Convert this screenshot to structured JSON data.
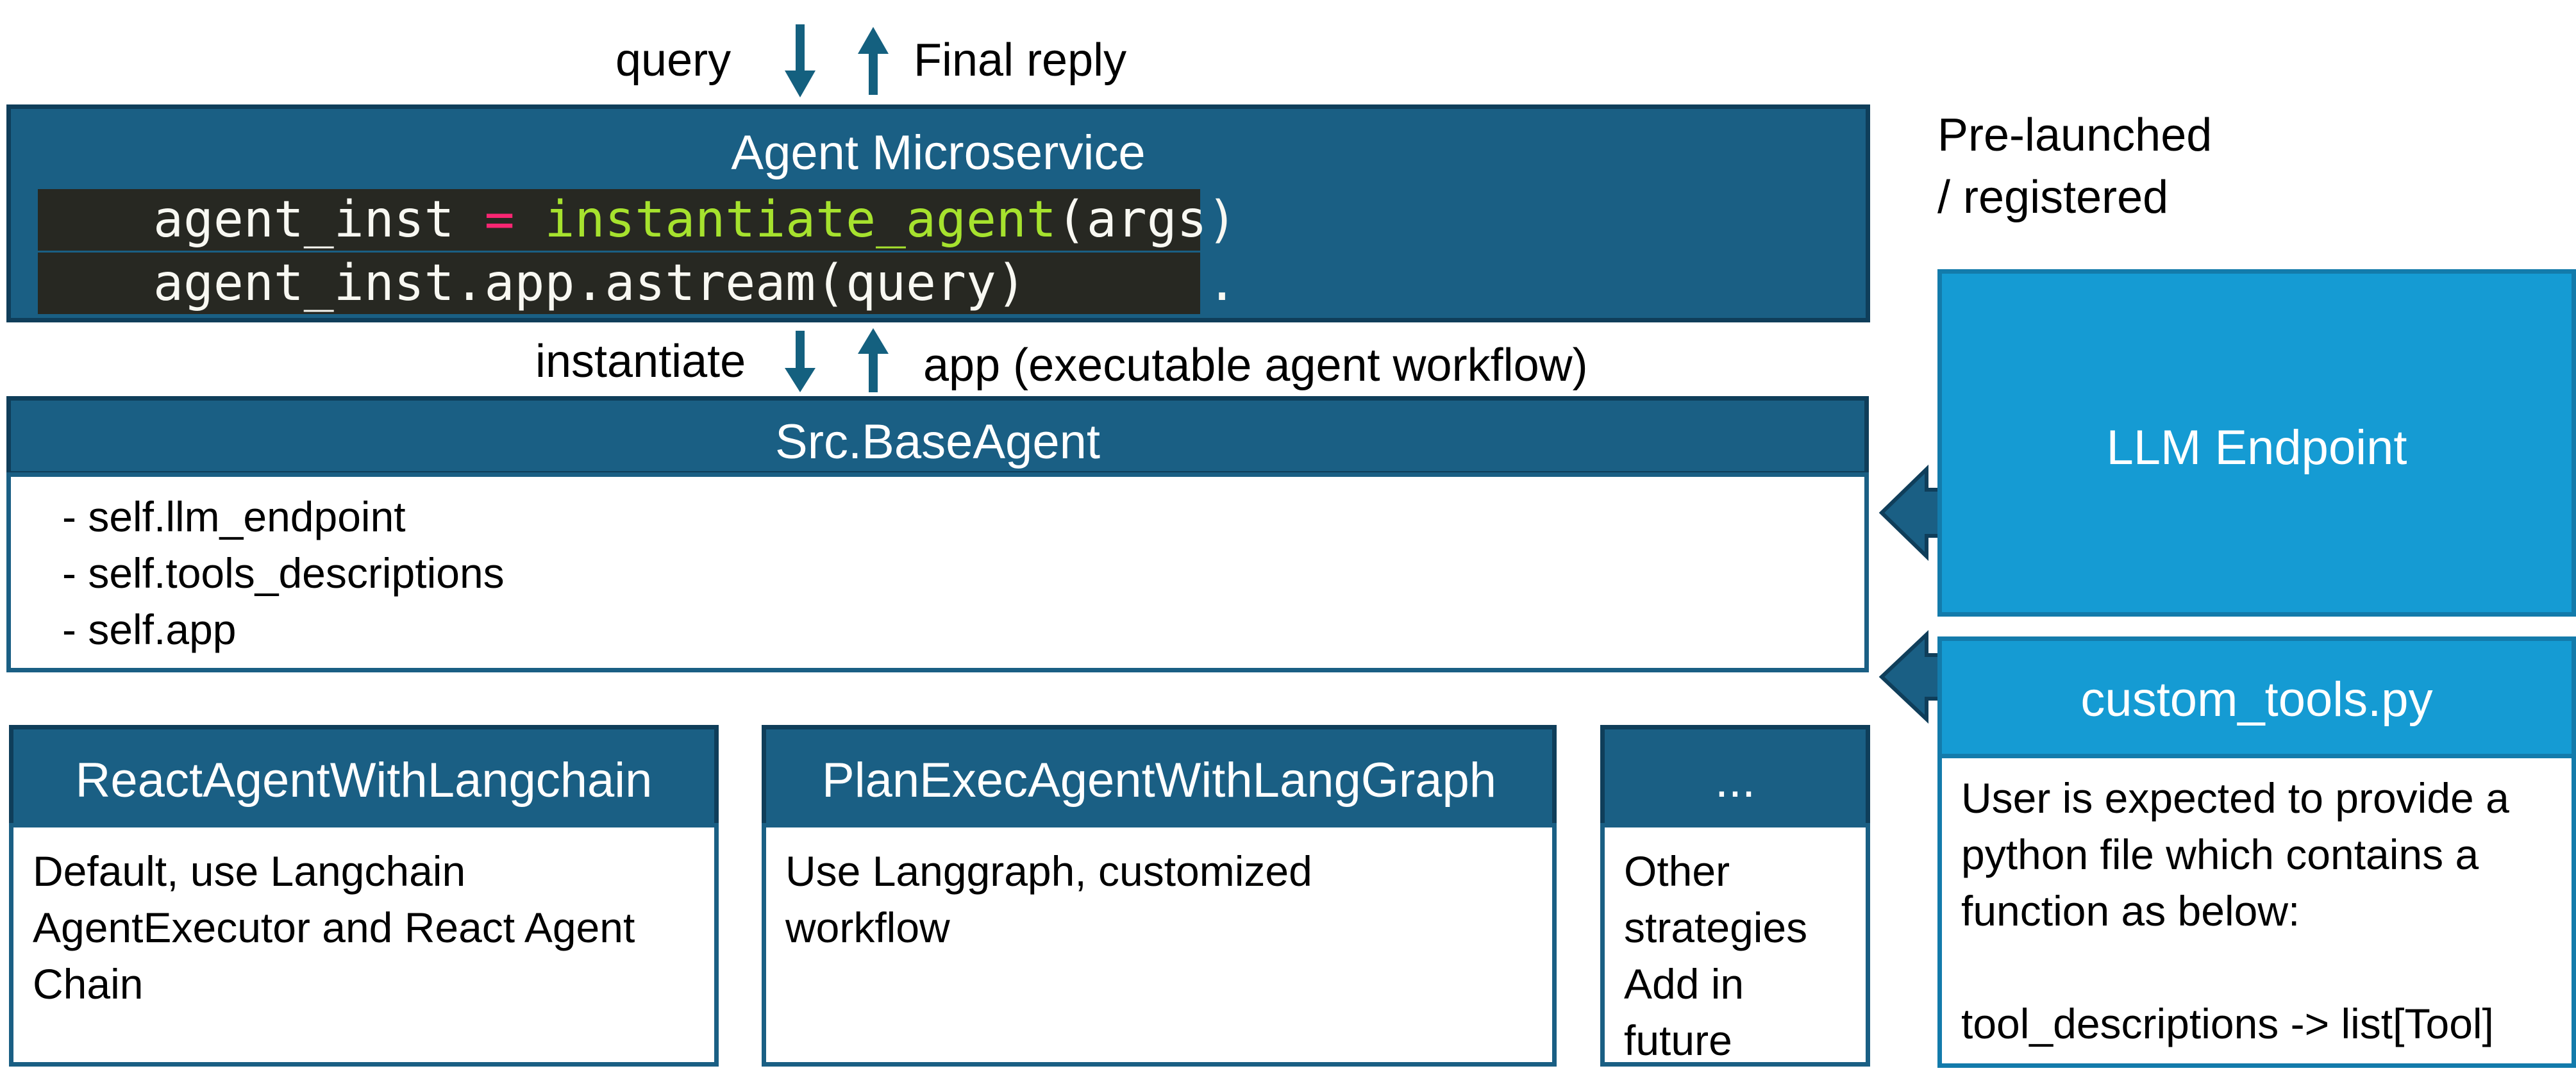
{
  "colors": {
    "dark_box": "#1a5f84",
    "light_box": "#159bd3",
    "arrow": "#14607f",
    "code_bg": "#272822",
    "code_keyword": "#f92672",
    "code_function": "#a6e22e"
  },
  "top_labels": {
    "query": "query",
    "final_reply": "Final reply"
  },
  "agent_microservice": {
    "title": "Agent  Microservice",
    "code_line1": {
      "a": "agent_inst ",
      "eq": "=",
      "sp": " ",
      "fn": "instantiate_agent",
      "b": "(args)"
    },
    "code_line2": "agent_inst.app.astream(query)      ."
  },
  "mid_labels": {
    "instantiate": "instantiate",
    "app": "app (executable agent workflow)"
  },
  "base_agent": {
    "title": "Src.BaseAgent",
    "items": [
      "- self.llm_endpoint",
      "- self.tools_descriptions",
      "- self.app"
    ]
  },
  "right_panel": {
    "note_line1": "Pre-launched",
    "note_line2": "/ registered",
    "llm_endpoint": "LLM Endpoint",
    "custom_tools": {
      "title": "custom_tools.py",
      "lines": [
        "User is expected to provide a",
        "python file which contains a",
        "function as below:",
        "",
        "tool_descriptions -> list[Tool]"
      ]
    }
  },
  "strategies": [
    {
      "title": "ReactAgentWithLangchain",
      "lines": [
        "Default, use Langchain",
        "AgentExecutor and React Agent",
        "Chain"
      ]
    },
    {
      "title": "PlanExecAgentWithLangGraph",
      "lines": [
        "Use Langgraph, customized",
        "workflow"
      ]
    },
    {
      "title": "...",
      "lines": [
        "Other",
        "strategies",
        "Add in",
        "future"
      ]
    }
  ]
}
